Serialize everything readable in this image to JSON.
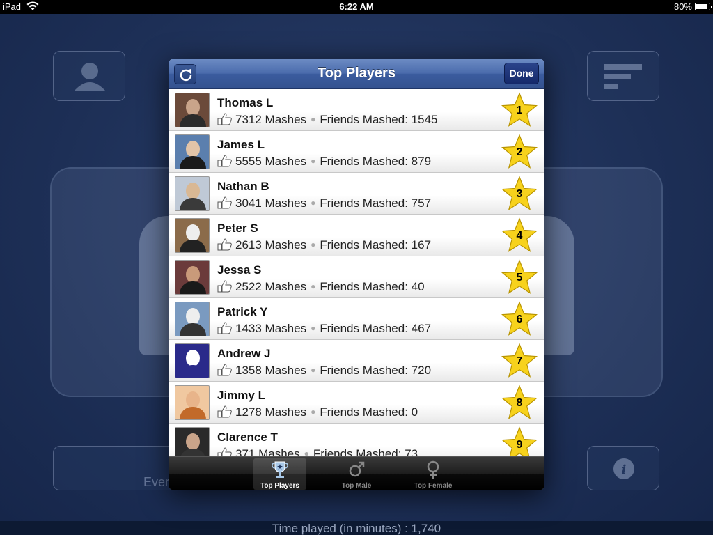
{
  "status_bar": {
    "device": "iPad",
    "time": "6:22 AM",
    "battery": "80%",
    "battery_level": 0.8
  },
  "background": {
    "every_text": "Ever",
    "time_played": "Time played (in minutes) : 1,740"
  },
  "popover": {
    "title": "Top Players",
    "done_label": "Done",
    "players": [
      {
        "name": "Thomas L",
        "mashes": "7312 Mashes",
        "friends": "Friends Mashed: 1545",
        "rank": "1"
      },
      {
        "name": "James L",
        "mashes": "5555 Mashes",
        "friends": "Friends Mashed: 879",
        "rank": "2"
      },
      {
        "name": "Nathan B",
        "mashes": "3041 Mashes",
        "friends": "Friends Mashed: 757",
        "rank": "3"
      },
      {
        "name": "Peter S",
        "mashes": "2613 Mashes",
        "friends": "Friends Mashed: 167",
        "rank": "4"
      },
      {
        "name": "Jessa S",
        "mashes": "2522 Mashes",
        "friends": "Friends Mashed: 40",
        "rank": "5"
      },
      {
        "name": "Patrick Y",
        "mashes": "1433 Mashes",
        "friends": "Friends Mashed: 467",
        "rank": "6"
      },
      {
        "name": "Andrew J",
        "mashes": "1358 Mashes",
        "friends": "Friends Mashed: 720",
        "rank": "7"
      },
      {
        "name": "Jimmy L",
        "mashes": "1278 Mashes",
        "friends": "Friends Mashed: 0",
        "rank": "8"
      },
      {
        "name": "Clarence T",
        "mashes": "371 Mashes",
        "friends": "Friends Mashed: 73",
        "rank": "9"
      }
    ],
    "tabs": [
      {
        "label": "Top Players",
        "icon": "trophy-icon",
        "active": true
      },
      {
        "label": "Top Male",
        "icon": "male-symbol-icon",
        "active": false
      },
      {
        "label": "Top Female",
        "icon": "female-symbol-icon",
        "active": false
      }
    ]
  },
  "colors": {
    "nav_blue": "#3b5c9f",
    "star_yellow": "#f7d21c",
    "background_navy": "#1d2f56"
  }
}
